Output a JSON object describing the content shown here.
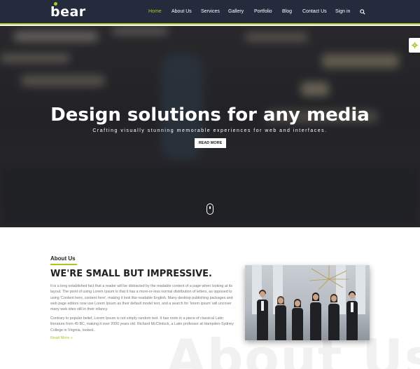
{
  "header": {
    "logo_text": "bear",
    "nav": [
      {
        "label": "Home",
        "active": true
      },
      {
        "label": "About Us",
        "active": false
      },
      {
        "label": "Services",
        "active": false
      },
      {
        "label": "Gallery",
        "active": false
      },
      {
        "label": "Portfolio",
        "active": false
      },
      {
        "label": "Blog",
        "active": false
      },
      {
        "label": "Contact Us",
        "active": false
      },
      {
        "label": "Sign in",
        "active": false
      }
    ],
    "search_icon": "search-icon",
    "accent_color": "#a8c920",
    "background_color": "#242b3d"
  },
  "hero": {
    "title": "Design solutions for any media",
    "subtitle": "Crafting visually stunning memorable experiences for web and interfaces.",
    "button_label": "READ MORE",
    "scroll_icon": "mouse-scroll-icon"
  },
  "settings": {
    "icon": "gear-icon"
  },
  "about": {
    "label": "About Us",
    "heading": "WE'RE SMALL BUT IMPRESSIVE.",
    "paragraph1": "It is a long established fact that a reader will be distracted by the readable content of a page when looking at its layout. The point of using Lorem Ipsum is that it has a more-or-less normal distribution of letters, as opposed to using 'Content here, content here', making it look like readable English. Many desktop publishing packages and web page editors now use Lorem Ipsum as their default model text, and a search for 'lorem ipsum' will uncover many web sites still in their infancy.",
    "paragraph2": "Contrary to popular belief, Lorem Ipsum is not simply random text. It has roots in a piece of classical Latin literature from 45 BC, making it over 2000 years old. Richard McClintock, a Latin professor at Hampden-Sydney College in Virginia, looked..",
    "read_more": "Read More »",
    "background_text": "About Us"
  }
}
